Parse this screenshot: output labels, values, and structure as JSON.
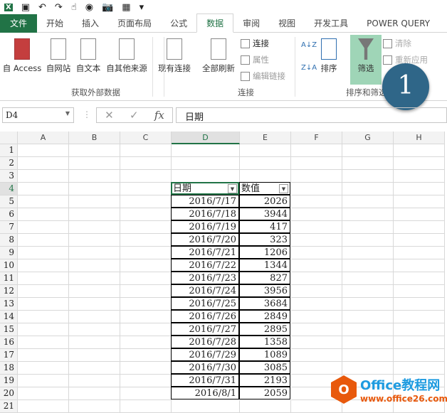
{
  "qat": {
    "icons": [
      "excel-icon",
      "save-icon",
      "undo-icon",
      "redo-icon",
      "touch-icon",
      "circle-icon",
      "camera-icon",
      "form-icon",
      "customize-icon"
    ],
    "glyphs": [
      "X",
      "▣",
      "↶",
      "↷",
      "☝",
      "◉",
      "📷",
      "▦",
      "▾"
    ]
  },
  "tabs": [
    "文件",
    "开始",
    "插入",
    "页面布局",
    "公式",
    "数据",
    "审阅",
    "视图",
    "开发工具",
    "POWER QUERY"
  ],
  "active_tab": "数据",
  "ribbon": {
    "get_external": {
      "buttons": [
        "自 Access",
        "自网站",
        "自文本",
        "自其他来源",
        "现有连接"
      ],
      "label": "获取外部数据"
    },
    "connections": {
      "refresh": "全部刷新",
      "items": [
        "连接",
        "属性",
        "编辑链接"
      ],
      "label": "连接"
    },
    "sort_filter": {
      "sort": "排序",
      "filter": "筛选",
      "clear": "清除",
      "reapply": "重新应用",
      "label": "排序和筛选",
      "az": "A↓Z",
      "za": "Z↓A",
      "sort_icon": "ZA AZ"
    }
  },
  "formula_bar": {
    "name_box": "D4",
    "cancel": "✕",
    "enter": "✓",
    "fx": "fx",
    "formula": "日期"
  },
  "columns": [
    "A",
    "B",
    "C",
    "D",
    "E",
    "F",
    "G",
    "H"
  ],
  "rows": [
    "1",
    "2",
    "3",
    "4",
    "5",
    "6",
    "7",
    "8",
    "9",
    "10",
    "11",
    "12",
    "13",
    "14",
    "15",
    "16",
    "17",
    "18",
    "19",
    "20",
    "21"
  ],
  "table": {
    "headers": [
      "日期",
      "数值"
    ],
    "rows": [
      [
        "2016/7/17",
        "2026"
      ],
      [
        "2016/7/18",
        "3944"
      ],
      [
        "2016/7/19",
        "417"
      ],
      [
        "2016/7/20",
        "323"
      ],
      [
        "2016/7/21",
        "1206"
      ],
      [
        "2016/7/22",
        "1344"
      ],
      [
        "2016/7/23",
        "827"
      ],
      [
        "2016/7/24",
        "3956"
      ],
      [
        "2016/7/25",
        "3684"
      ],
      [
        "2016/7/26",
        "2849"
      ],
      [
        "2016/7/27",
        "2895"
      ],
      [
        "2016/7/28",
        "1358"
      ],
      [
        "2016/7/29",
        "1089"
      ],
      [
        "2016/7/30",
        "3085"
      ],
      [
        "2016/7/31",
        "2193"
      ],
      [
        "2016/8/1",
        "2059"
      ]
    ]
  },
  "callout": "1",
  "watermark": {
    "title": "Office教程网",
    "url": "www.office26.com"
  },
  "colors": {
    "accent": "#217346",
    "badge": "#2f6688",
    "logo": "#e8590c"
  }
}
